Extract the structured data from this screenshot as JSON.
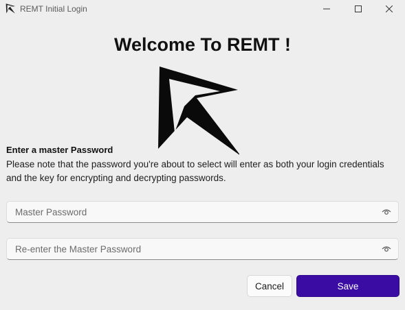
{
  "window": {
    "title": "REMT Initial Login",
    "controls": {
      "minimize_icon": "minimize-icon",
      "maximize_icon": "maximize-icon",
      "close_icon": "close-icon"
    }
  },
  "main": {
    "heading": "Welcome To REMT !",
    "logo_icon": "remt-logo",
    "field_label": "Enter a master Password",
    "note": "Please note that the password you're about to select will enter as both your login credentials and the key for encrypting and decrypting passwords.",
    "fields": [
      {
        "placeholder": "Master Password",
        "value": "",
        "icon": "eye-icon"
      },
      {
        "placeholder": "Re-enter the Master Password",
        "value": "",
        "icon": "eye-icon"
      }
    ]
  },
  "actions": {
    "cancel_label": "Cancel",
    "save_label": "Save"
  },
  "colors": {
    "background": "#eeeeee",
    "accent": "#3a0ca3",
    "text": "#111111"
  }
}
